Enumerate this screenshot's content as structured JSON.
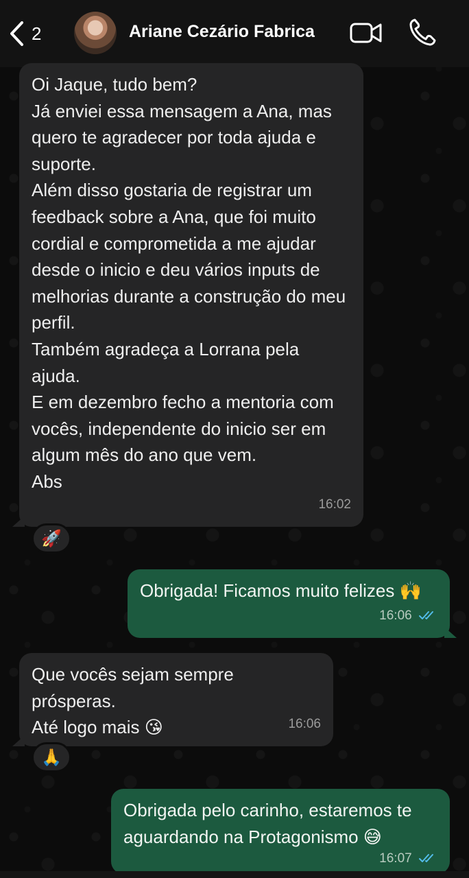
{
  "header": {
    "back_count": "2",
    "contact_name": "Ariane Cezário Fabrica"
  },
  "messages": [
    {
      "direction": "in",
      "text": "Oi Jaque, tudo bem?\nJá enviei essa mensagem a Ana, mas quero te agradecer por toda ajuda e suporte.\nAlém disso gostaria de registrar um feedback sobre a Ana, que foi muito cordial e comprometida a me ajudar desde o inicio e deu vários inputs de melhorias durante a construção do meu perfil.\nTambém agradeça a Lorrana pela ajuda.\nE em dezembro fecho a mentoria com vocês, independente do inicio ser em algum mês do ano que vem.\nAbs",
      "time": "16:02",
      "reaction": "🚀"
    },
    {
      "direction": "out",
      "text": "Obrigada! Ficamos muito felizes 🙌",
      "time": "16:06",
      "status": "read"
    },
    {
      "direction": "in",
      "text": "Que vocês sejam sempre prósperas.\nAté logo mais 😘",
      "time": "16:06",
      "reaction": "🙏"
    },
    {
      "direction": "out",
      "text": "Obrigada pelo carinho, estaremos te aguardando na Protagonismo 😅",
      "time": "16:07",
      "status": "read"
    }
  ],
  "colors": {
    "incoming_bubble": "#252526",
    "outgoing_bubble": "#1c5a3f",
    "read_ticks": "#53bdeb"
  }
}
